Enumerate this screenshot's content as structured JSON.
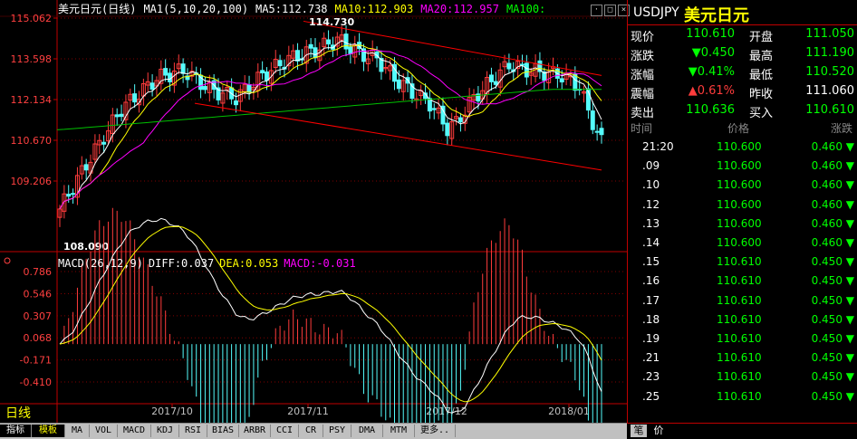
{
  "chart_header": {
    "symbol": "美元日元(日线)",
    "ma_label": "MA1(5,10,20,100)",
    "ma5": "MA5:112.738",
    "ma10": "MA10:112.903",
    "ma20": "MA20:112.957",
    "ma100": "MA100:"
  },
  "macd_header": {
    "label": "MACD(26,12,9)",
    "diff": "DIFF:0.037",
    "dea": "DEA:0.053",
    "macd": "MACD:-0.031"
  },
  "colors": {
    "up": "#ff3c3c",
    "down": "#54fcfc",
    "ma5": "#ffffff",
    "ma10": "#ffff00",
    "ma20": "#ff00ff",
    "ma100": "#00c000",
    "channel": "#ff0000"
  },
  "chart_data": {
    "type": "candlestick",
    "price_axis_ticks": [
      "115.062",
      "113.598",
      "112.134",
      "110.670",
      "109.206"
    ],
    "macd_axis_ticks": [
      "0.786",
      "0.546",
      "0.307",
      "0.068",
      "-0.171",
      "-0.410"
    ],
    "x_labels": [
      "2017/10",
      "2017/11",
      "2017/12",
      "2018/01"
    ],
    "annotations": {
      "high": "114.730",
      "low": "108.090"
    }
  },
  "quote": {
    "symbol": "USDJPY",
    "name": "美元日元",
    "rows": [
      {
        "l1": "现价",
        "v1": "110.610",
        "c1": "#00ff00",
        "l2": "开盘",
        "v2": "111.050",
        "c2": "#00ff00"
      },
      {
        "l1": "涨跌",
        "v1": "▼0.450",
        "c1": "#00ff00",
        "l2": "最高",
        "v2": "111.190",
        "c2": "#00ff00"
      },
      {
        "l1": "涨幅",
        "v1": "▼0.41%",
        "c1": "#00ff00",
        "l2": "最低",
        "v2": "110.520",
        "c2": "#00ff00"
      },
      {
        "l1": "震幅",
        "v1": "▲0.61%",
        "c1": "#ff3c3c",
        "l2": "昨收",
        "v2": "111.060",
        "c2": "#ffffff"
      },
      {
        "l1": "卖出",
        "v1": "110.636",
        "c1": "#00ff00",
        "l2": "买入",
        "v2": "110.610",
        "c2": "#00ff00"
      }
    ]
  },
  "ticks_header": {
    "time": "时间",
    "price": "价格",
    "change": "涨跌"
  },
  "ticks": [
    {
      "t": "21:20",
      "p": "110.600",
      "c": "0.460 ▼"
    },
    {
      "t": ".09",
      "p": "110.600",
      "c": "0.460 ▼"
    },
    {
      "t": ".10",
      "p": "110.600",
      "c": "0.460 ▼"
    },
    {
      "t": ".12",
      "p": "110.600",
      "c": "0.460 ▼"
    },
    {
      "t": ".13",
      "p": "110.600",
      "c": "0.460 ▼"
    },
    {
      "t": ".14",
      "p": "110.600",
      "c": "0.460 ▼"
    },
    {
      "t": ".15",
      "p": "110.610",
      "c": "0.450 ▼"
    },
    {
      "t": ".16",
      "p": "110.610",
      "c": "0.450 ▼"
    },
    {
      "t": ".17",
      "p": "110.610",
      "c": "0.450 ▼"
    },
    {
      "t": ".18",
      "p": "110.610",
      "c": "0.450 ▼"
    },
    {
      "t": ".19",
      "p": "110.610",
      "c": "0.450 ▼"
    },
    {
      "t": ".21",
      "p": "110.610",
      "c": "0.450 ▼"
    },
    {
      "t": ".23",
      "p": "110.610",
      "c": "0.450 ▼"
    },
    {
      "t": ".25",
      "p": "110.610",
      "c": "0.450 ▼"
    }
  ],
  "period_label": "日线",
  "bottom_tabs": [
    "指标",
    "模板",
    "MA",
    "VOL",
    "MACD",
    "KDJ",
    "RSI",
    "BIAS",
    "ARBR",
    "CCI",
    "CR",
    "PSY",
    "DMA",
    "MTM",
    "更多.."
  ],
  "side_tabs": [
    "笔",
    "价"
  ]
}
